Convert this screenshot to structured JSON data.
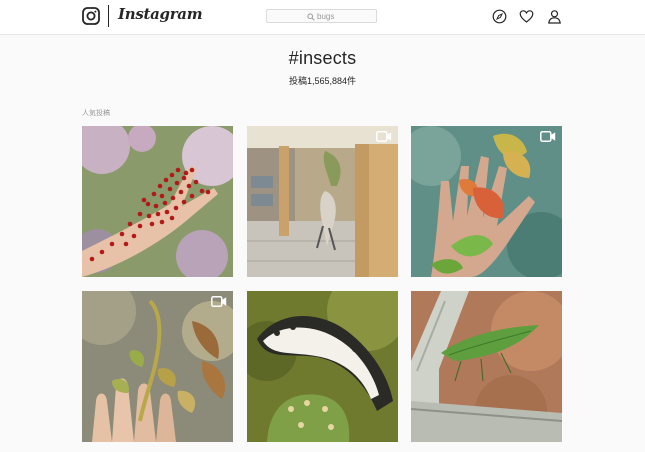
{
  "nav": {
    "logo_icon": "instagram-camera-icon",
    "wordmark": "Instagram",
    "search": {
      "placeholder": "bugs",
      "icon": "search-icon"
    },
    "icons": [
      "compass-icon",
      "heart-icon",
      "person-icon"
    ]
  },
  "header": {
    "hashtag": "#insects",
    "post_count": "投稿1,565,884件"
  },
  "section": {
    "label": "人気投稿"
  },
  "grid": {
    "posts": [
      {
        "subject": "hand with red ladybugs",
        "video": false
      },
      {
        "subject": "hanging leaf insect",
        "video": true
      },
      {
        "subject": "hand holding leaf insects",
        "video": true
      },
      {
        "subject": "fingers with dried leaf mimic insects",
        "video": true
      },
      {
        "subject": "caterpillar on cactus",
        "video": false
      },
      {
        "subject": "green leaf insect on wall",
        "video": false
      }
    ]
  },
  "colors": {
    "background": "#fafafa",
    "nav_background": "#ffffff",
    "border": "#e6e6e6",
    "text": "#262626",
    "muted": "#999999"
  }
}
